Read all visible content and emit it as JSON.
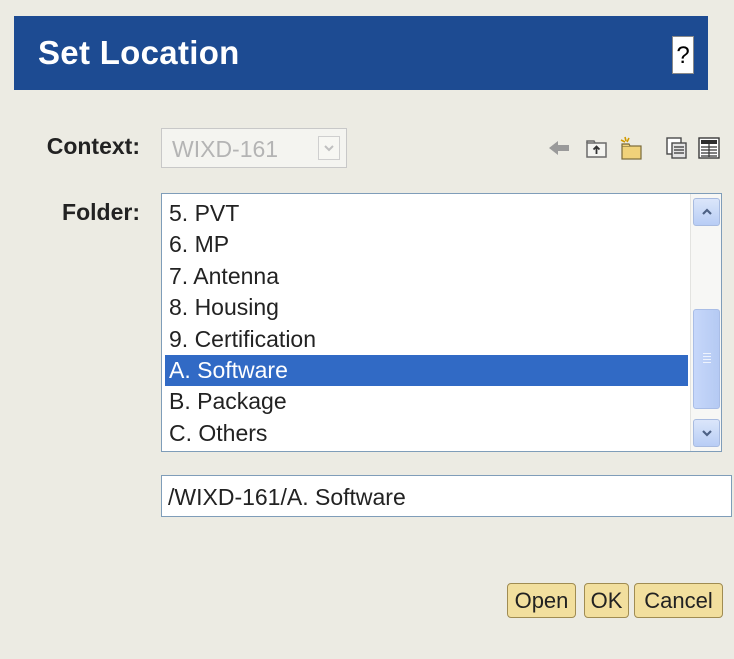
{
  "dialog": {
    "title": "Set Location",
    "help_label": "?"
  },
  "context": {
    "label": "Context:",
    "value": "WIXD-161"
  },
  "toolbar": {
    "icons": [
      "back-arrow-icon",
      "up-folder-icon",
      "new-folder-icon",
      "view-list-icon",
      "view-details-icon"
    ]
  },
  "folder": {
    "label": "Folder:",
    "items": [
      {
        "label": "5. PVT",
        "selected": false
      },
      {
        "label": "6. MP",
        "selected": false
      },
      {
        "label": "7. Antenna",
        "selected": false
      },
      {
        "label": "8. Housing",
        "selected": false
      },
      {
        "label": "9. Certification",
        "selected": false
      },
      {
        "label": "A. Software",
        "selected": true
      },
      {
        "label": "B. Package",
        "selected": false
      },
      {
        "label": "C. Others",
        "selected": false
      }
    ]
  },
  "path": {
    "value": "/WIXD-161/A. Software"
  },
  "buttons": {
    "open": "Open",
    "ok": "OK",
    "cancel": "Cancel"
  },
  "colors": {
    "background": "#ecebe3",
    "title_bar": "#1d4b92",
    "selection": "#316ac5",
    "button": "#f2df9e"
  }
}
